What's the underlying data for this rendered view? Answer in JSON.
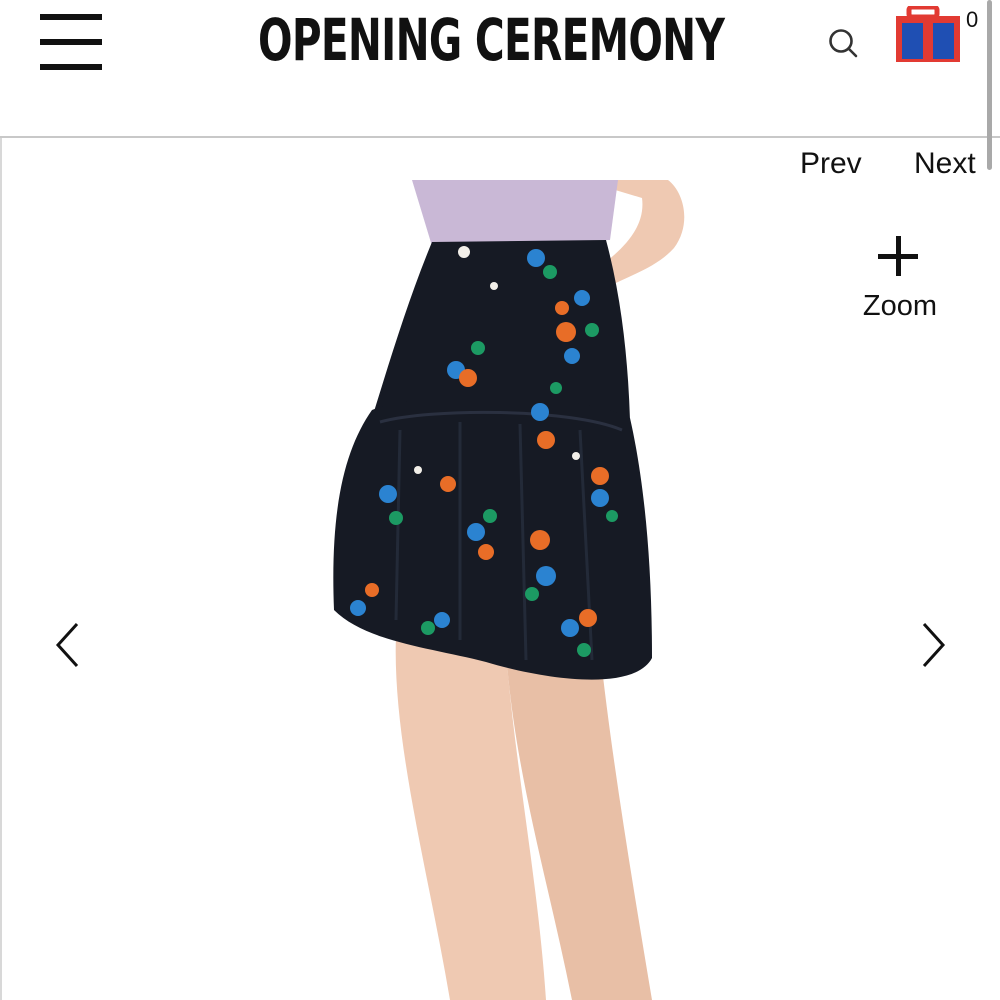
{
  "header": {
    "brand_name": "OPENING CEREMONY",
    "cart_count": "0",
    "icons": {
      "menu": "hamburger-menu-icon",
      "search": "search-icon",
      "cart": "shopping-bag-icon"
    }
  },
  "gallery": {
    "prev_label": "Prev",
    "next_label": "Next",
    "zoom_label": "Zoom",
    "icons": {
      "zoom": "plus-icon",
      "previous": "chevron-left-icon",
      "next": "chevron-right-icon"
    }
  },
  "colors": {
    "skirt": "#161a24",
    "top": "#c9b8d6",
    "skin": "#efc9b2",
    "print_blue": "#2b83d1",
    "print_orange": "#e86d27",
    "print_green": "#1c9a63",
    "cart_red": "#e23a32",
    "cart_blue": "#1f4fb3"
  }
}
